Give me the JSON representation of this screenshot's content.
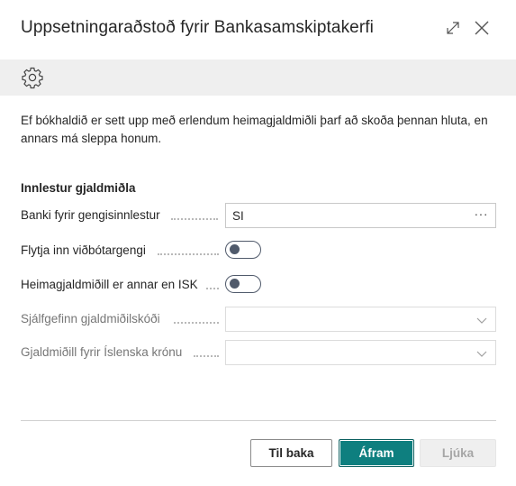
{
  "dialog": {
    "title": "Uppsetningaraðstoð fyrir Bankasamskiptakerfi",
    "window_controls": {
      "expand_icon": "expand-icon",
      "close_icon": "close-icon"
    }
  },
  "action_bar": {
    "settings_icon": "gear-icon"
  },
  "intro_text": "Ef bókhaldið er sett upp með erlendum heimagjaldmiðli þarf að skoða þennan hluta, en annars má sleppa honum.",
  "section": {
    "title": "Innlestur gjaldmiðla",
    "fields": [
      {
        "label": "Banki fyrir gengisinnlestur",
        "type": "lookup",
        "value": "SI",
        "more_label": "···"
      },
      {
        "label": "Flytja inn viðbótargengi",
        "type": "toggle",
        "checked": false
      },
      {
        "label": "Heimagjaldmiðill er annar en ISK",
        "type": "toggle",
        "checked": false
      },
      {
        "label": "Sjálfgefinn gjaldmiðilskóði",
        "type": "dropdown",
        "value": "",
        "disabled": true
      },
      {
        "label": "Gjaldmiðill fyrir Íslenska krónu",
        "type": "dropdown",
        "value": "",
        "disabled": true
      }
    ]
  },
  "footer": {
    "back_label": "Til baka",
    "next_label": "Áfram",
    "finish_label": "Ljúka"
  },
  "colors": {
    "primary": "#0e7f7f",
    "toggle": "#505a6b",
    "action_bar": "#efefef"
  }
}
